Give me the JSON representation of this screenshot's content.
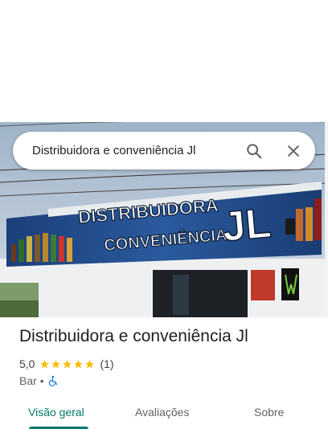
{
  "search": {
    "query": "Distribuidora e conveniência Jl",
    "search_icon": "search-icon",
    "close_icon": "close-icon"
  },
  "photo": {
    "sign_line1": "DISTRIBUIDORA",
    "sign_line2": "CONVENIÊNCIA",
    "sign_logo": "JL"
  },
  "place": {
    "title": "Distribuidora e conveniência Jl",
    "rating": "5,0",
    "stars": 5,
    "reviews_count": "(1)",
    "category": "Bar",
    "separator": "•",
    "accessibility_icon": "wheelchair-icon"
  },
  "tabs": [
    {
      "label": "Visão geral",
      "active": true
    },
    {
      "label": "Avaliações",
      "active": false
    },
    {
      "label": "Sobre",
      "active": false
    }
  ],
  "colors": {
    "accent": "#00796b",
    "star": "#fbbc04",
    "accessibility": "#1a73e8"
  }
}
